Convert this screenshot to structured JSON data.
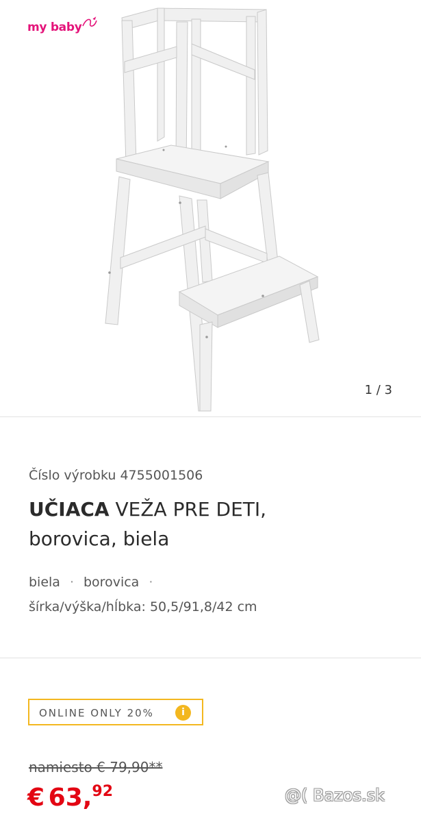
{
  "gallery": {
    "logo_text": "my baby",
    "counter": "1 / 3",
    "image": "white wooden learning tower"
  },
  "product": {
    "sku_label": "Číslo výrobku 4755001506",
    "title_bold": "UČIACA",
    "title_rest": " VEŽA PRE DETI,",
    "title_line2": "borovica, biela",
    "attributes": [
      "biela",
      "borovica"
    ],
    "dimensions": "šírka/výška/hĺbka: 50,5/91,8/42 cm"
  },
  "pricing": {
    "badge_text": "ONLINE ONLY 20%",
    "badge_icon": "i",
    "old_price": "namiesto € 79,90**",
    "currency": "€",
    "price_int": "63,",
    "price_dec": "92"
  },
  "watermark": "@( Bazos.sk",
  "colors": {
    "brand_pink": "#e4147a",
    "price_red": "#e30613",
    "badge_yellow": "#f3b71f"
  }
}
